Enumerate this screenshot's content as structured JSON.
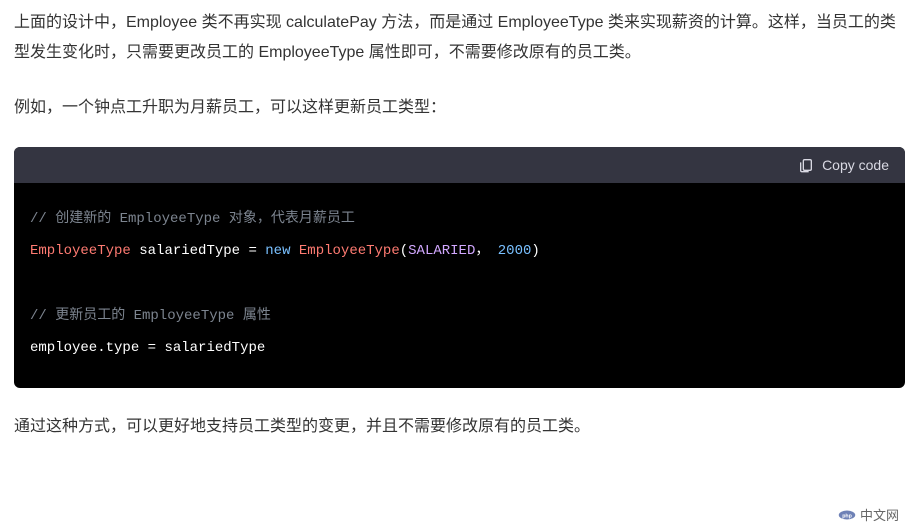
{
  "paragraphs": {
    "p1": "上面的设计中，Employee 类不再实现 calculatePay 方法，而是通过 EmployeeType 类来实现薪资的计算。这样，当员工的类型发生变化时，只需要更改员工的 EmployeeType 属性即可，不需要修改原有的员工类。",
    "p2": "例如，一个钟点工升职为月薪员工，可以这样更新员工类型：",
    "p3": "通过这种方式，可以更好地支持员工类型的变更，并且不需要修改原有的员工类。"
  },
  "code": {
    "copy_label": "Copy code",
    "line1_comment": "// 创建新的 EmployeeType 对象，代表月薪员工",
    "line2": {
      "type1": "EmployeeType",
      "var": "salariedType",
      "eq": "=",
      "new": "new",
      "type2": "EmployeeType",
      "lparen": "(",
      "arg1": "SALARIED",
      "comma": "，",
      "arg2": "2000",
      "rparen": ")"
    },
    "line3_comment": "// 更新员工的 EmployeeType 属性",
    "line4": {
      "obj": "employee",
      "dot": ".",
      "prop": "type",
      "eq": "=",
      "val": "salariedType"
    }
  },
  "watermark": {
    "text": "中文网"
  }
}
